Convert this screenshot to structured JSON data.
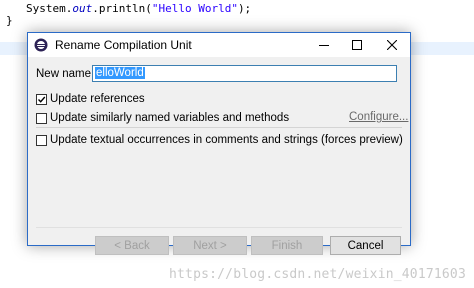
{
  "editor": {
    "code_line_1_prefix": "System.",
    "code_line_1_out": "out",
    "code_line_1_call": ".println(",
    "code_line_1_string": "\"Hello World\"",
    "code_line_1_suffix": ");",
    "code_line_2": "}",
    "watermark": "https://blog.csdn.net/weixin_40171603"
  },
  "dialog": {
    "title": "Rename Compilation Unit",
    "titlebar_icons": [
      "minimize-icon",
      "maximize-icon",
      "close-icon"
    ],
    "new_name_label": "New name:",
    "new_name_value": "elloWorld",
    "checkboxes": [
      {
        "label": "Update references",
        "checked": true
      },
      {
        "label": "Update similarly named variables and methods",
        "checked": false
      },
      {
        "label": "Update textual occurrences in comments and strings (forces preview)",
        "checked": false
      }
    ],
    "configure_link": "Configure...",
    "buttons": {
      "back": "< Back",
      "next": "Next >",
      "finish": "Finish",
      "cancel": "Cancel"
    }
  }
}
